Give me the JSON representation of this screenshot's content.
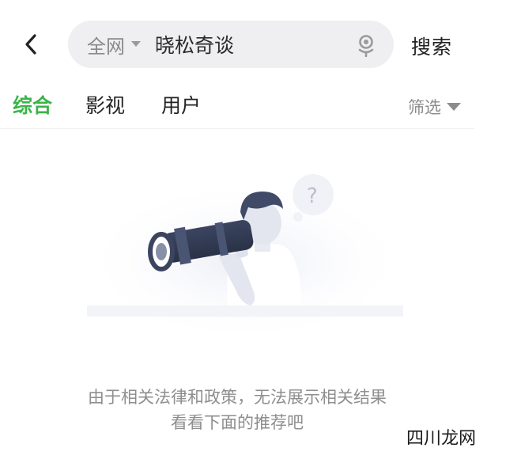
{
  "search": {
    "scope_label": "全网",
    "query": "晓松奇谈",
    "submit_label": "搜索"
  },
  "tabs": [
    {
      "label": "综合",
      "active": true
    },
    {
      "label": "影视",
      "active": false
    },
    {
      "label": "用户",
      "active": false
    }
  ],
  "filter": {
    "label": "筛选"
  },
  "empty_state": {
    "line1": "由于相关法律和政策，无法展示相关结果",
    "line2": "看看下面的推荐吧"
  },
  "watermark": {
    "text": "四川龙网"
  },
  "colors": {
    "accent": "#3cb34a",
    "search_bg": "#efeff1",
    "muted_text": "#8e8e8e"
  },
  "icons": {
    "back": "chevron-left-icon",
    "scope_caret": "caret-down-icon",
    "mic": "microphone-icon",
    "filter_caret": "caret-down-icon"
  }
}
